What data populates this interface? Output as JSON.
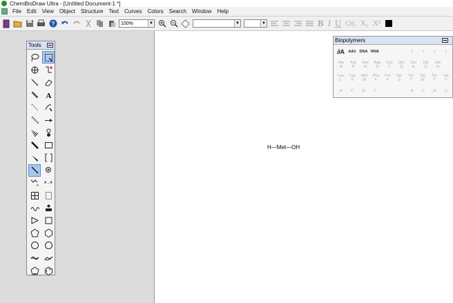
{
  "window": {
    "title": "ChemBioDraw Ultra - [Untitled Document-1 *]"
  },
  "menu": [
    "File",
    "Edit",
    "View",
    "Object",
    "Structure",
    "Text",
    "Curves",
    "Colors",
    "Search",
    "Window",
    "Help"
  ],
  "toolbar": {
    "zoom": "100%",
    "font": "",
    "size": "",
    "fmt_bold": "B",
    "fmt_italic": "I",
    "fmt_underline": "U",
    "fmt_formula": "CH₂",
    "fmt_sub": "X₂",
    "fmt_sup": "X²"
  },
  "tools": {
    "title": "Tools"
  },
  "molecule": {
    "text": "H—Met—OH"
  },
  "biopolymers": {
    "title": "Biopolymers",
    "row1": [
      "AA1",
      "DNA",
      "RNA"
    ],
    "row2": [
      [
        "Ala",
        "A"
      ],
      [
        "Arg",
        "R"
      ],
      [
        "Asn",
        "N"
      ],
      [
        "Asp",
        "D"
      ],
      [
        "Cys",
        "C"
      ],
      [
        "Gln",
        "Q"
      ],
      [
        "Glu",
        "E"
      ],
      [
        "Gly",
        "G"
      ],
      [
        "His",
        "H"
      ]
    ],
    "row3": [
      [
        "Leu",
        "L"
      ],
      [
        "Lys",
        "K"
      ],
      [
        "Met",
        "M"
      ],
      [
        "Phe",
        "F"
      ],
      [
        "Pro",
        "P"
      ],
      [
        "Ser",
        "S"
      ],
      [
        "Thr",
        "T"
      ],
      [
        "Trp",
        "W"
      ],
      [
        "Tyr",
        "Y"
      ],
      [
        "Val",
        "V"
      ]
    ],
    "row4": [
      "A",
      "C",
      "G",
      "T",
      "A",
      "C",
      "G",
      "U"
    ]
  }
}
